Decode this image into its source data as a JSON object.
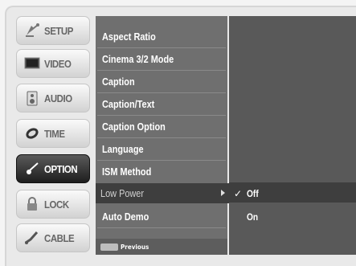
{
  "tabs": [
    {
      "label": "SETUP",
      "icon": "satellite-dish-icon"
    },
    {
      "label": "VIDEO",
      "icon": "tv-icon"
    },
    {
      "label": "AUDIO",
      "icon": "speaker-icon"
    },
    {
      "label": "TIME",
      "icon": "clock-icon"
    },
    {
      "label": "OPTION",
      "icon": "option-icon"
    },
    {
      "label": "LOCK",
      "icon": "lock-icon"
    },
    {
      "label": "CABLE",
      "icon": "cable-icon"
    }
  ],
  "active_tab": "OPTION",
  "menu": {
    "items": [
      "Aspect Ratio",
      "Cinema 3/2 Mode",
      "Caption",
      "Caption/Text",
      "Caption Option",
      "Language",
      "ISM Method",
      "Low Power",
      "Auto Demo"
    ],
    "selected_item": "Low Power",
    "footer_button": "MENU",
    "footer_label": "Previous"
  },
  "submenu": {
    "options": [
      "Off",
      "On"
    ],
    "checked": "Off",
    "check_mark": "✓"
  },
  "colors": {
    "menu_bg": "#6f6f6f",
    "submenu_bg": "#595959",
    "selected_bg": "#3e3e3e",
    "active_tab_bg": "#2a2a2a"
  }
}
